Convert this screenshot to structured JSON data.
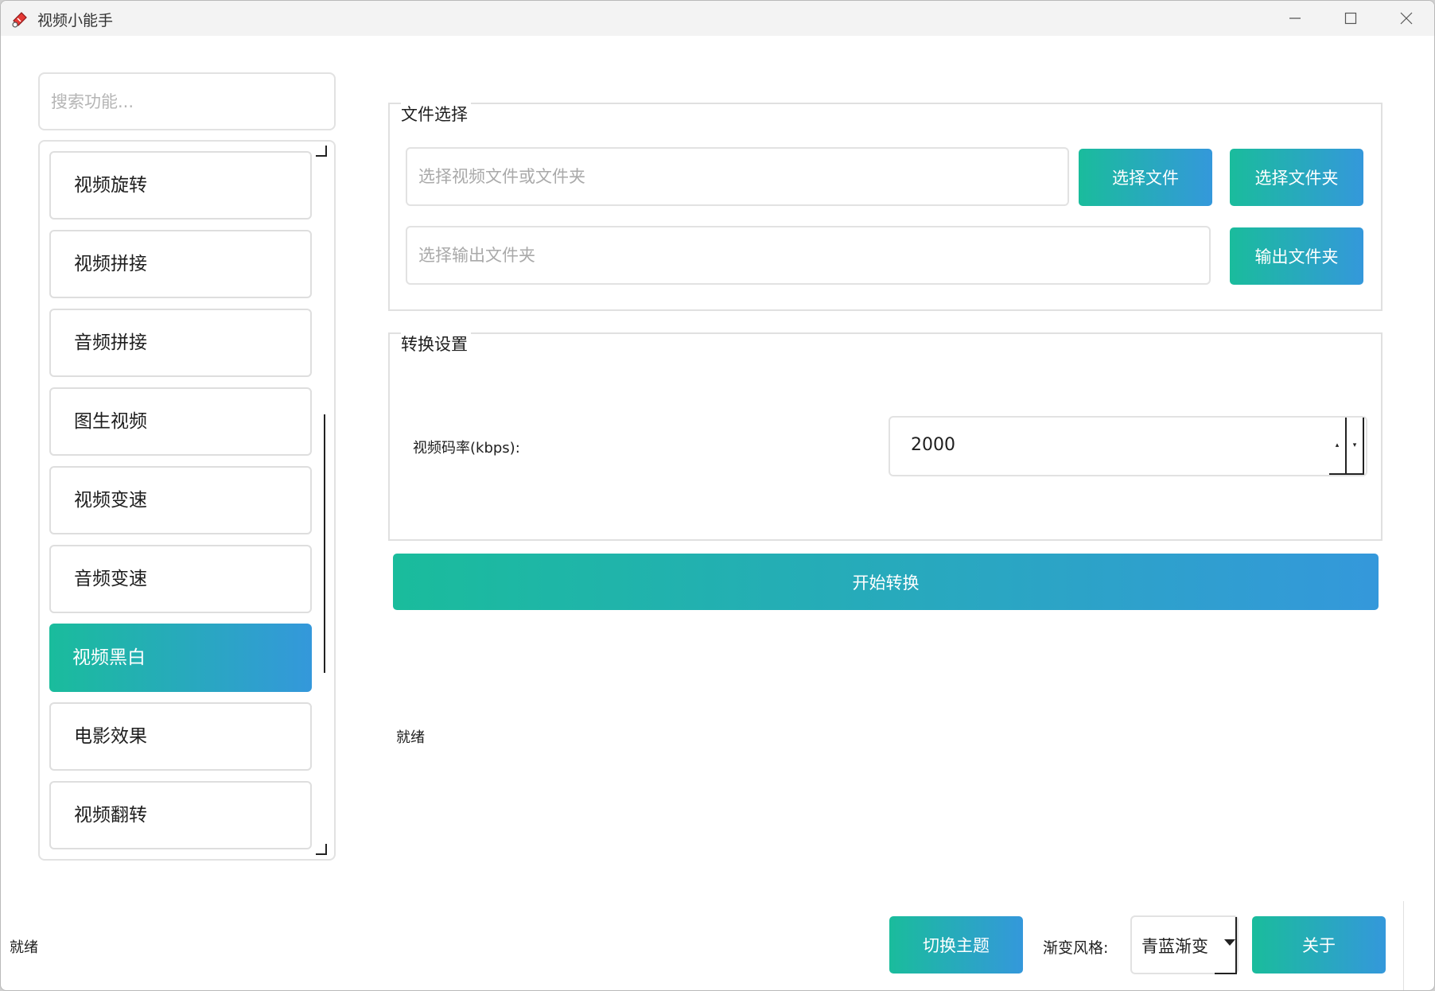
{
  "window": {
    "title": "视频小能手"
  },
  "sidebar": {
    "search_placeholder": "搜索功能...",
    "items": [
      {
        "label": "视频旋转",
        "active": false
      },
      {
        "label": "视频拼接",
        "active": false
      },
      {
        "label": "音频拼接",
        "active": false
      },
      {
        "label": "图生视频",
        "active": false
      },
      {
        "label": "视频变速",
        "active": false
      },
      {
        "label": "音频变速",
        "active": false
      },
      {
        "label": "视频黑白",
        "active": true
      },
      {
        "label": "电影效果",
        "active": false
      },
      {
        "label": "视频翻转",
        "active": false
      }
    ]
  },
  "file_group": {
    "title": "文件选择",
    "input_placeholder": "选择视频文件或文件夹",
    "input_value": "",
    "select_file_label": "选择文件",
    "select_folder_label": "选择文件夹",
    "output_placeholder": "选择输出文件夹",
    "output_value": "",
    "output_folder_label": "输出文件夹"
  },
  "settings_group": {
    "title": "转换设置",
    "bitrate_label": "视频码率(kbps):",
    "bitrate_value": "2000"
  },
  "actions": {
    "start_label": "开始转换"
  },
  "panel_status": "就绪",
  "footer": {
    "status": "就绪",
    "theme_button": "切换主题",
    "gradient_label": "渐变风格:",
    "gradient_value": "青蓝渐变",
    "about_button": "关于"
  },
  "colors": {
    "gradient_start": "#1abc9c",
    "gradient_end": "#3498db"
  }
}
